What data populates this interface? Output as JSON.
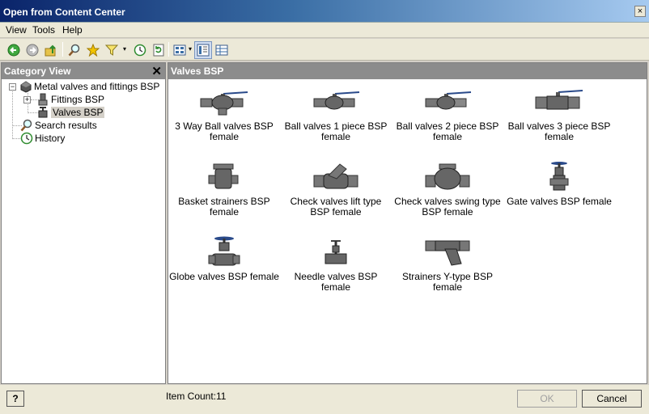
{
  "window": {
    "title": "Open from Content Center",
    "close_glyph": "×"
  },
  "menu": {
    "items": [
      "View",
      "Tools",
      "Help"
    ]
  },
  "toolbar": {
    "buttons": [
      "back-icon",
      "forward-icon",
      "up-folder-icon",
      "search-icon",
      "favorites-star-icon",
      "filter-icon",
      "history-icon",
      "refresh-icon",
      "view-options-icon",
      "detail-view-icon",
      "table-view-icon"
    ],
    "dropdown_glyph": "▾"
  },
  "category_view": {
    "title": "Category View",
    "close_glyph": "✕",
    "tree": [
      {
        "label": "Metal valves and fittings BSP",
        "expander": "−",
        "icon": "valve-category-icon"
      },
      {
        "label": "Fittings BSP",
        "expander": "+",
        "icon": "fitting-icon"
      },
      {
        "label": "Valves BSP",
        "icon": "valve-icon",
        "selected": true
      },
      {
        "label": "Search results",
        "icon": "search-results-icon"
      },
      {
        "label": "History",
        "icon": "history-icon"
      }
    ]
  },
  "content": {
    "title": "Valves BSP",
    "items": [
      {
        "label": "3 Way Ball valves BSP female",
        "icon": "ball-valve-3way-icon"
      },
      {
        "label": "Ball valves 1 piece BSP female",
        "icon": "ball-valve-1piece-icon"
      },
      {
        "label": "Ball valves 2 piece BSP female",
        "icon": "ball-valve-2piece-icon"
      },
      {
        "label": "Ball valves 3 piece BSP female",
        "icon": "ball-valve-3piece-icon"
      },
      {
        "label": "Basket strainers BSP female",
        "icon": "basket-strainer-icon"
      },
      {
        "label": "Check valves lift type BSP female",
        "icon": "check-valve-lift-icon"
      },
      {
        "label": "Check valves swing type BSP female",
        "icon": "check-valve-swing-icon"
      },
      {
        "label": "Gate valves BSP female",
        "icon": "gate-valve-icon"
      },
      {
        "label": "Globe valves BSP female",
        "icon": "globe-valve-icon"
      },
      {
        "label": "Needle valves BSP female",
        "icon": "needle-valve-icon"
      },
      {
        "label": "Strainers Y-type BSP female",
        "icon": "y-strainer-icon"
      }
    ]
  },
  "status": {
    "item_count": "Item Count:11",
    "help_label": "?",
    "ok_label": "OK",
    "cancel_label": "Cancel"
  }
}
